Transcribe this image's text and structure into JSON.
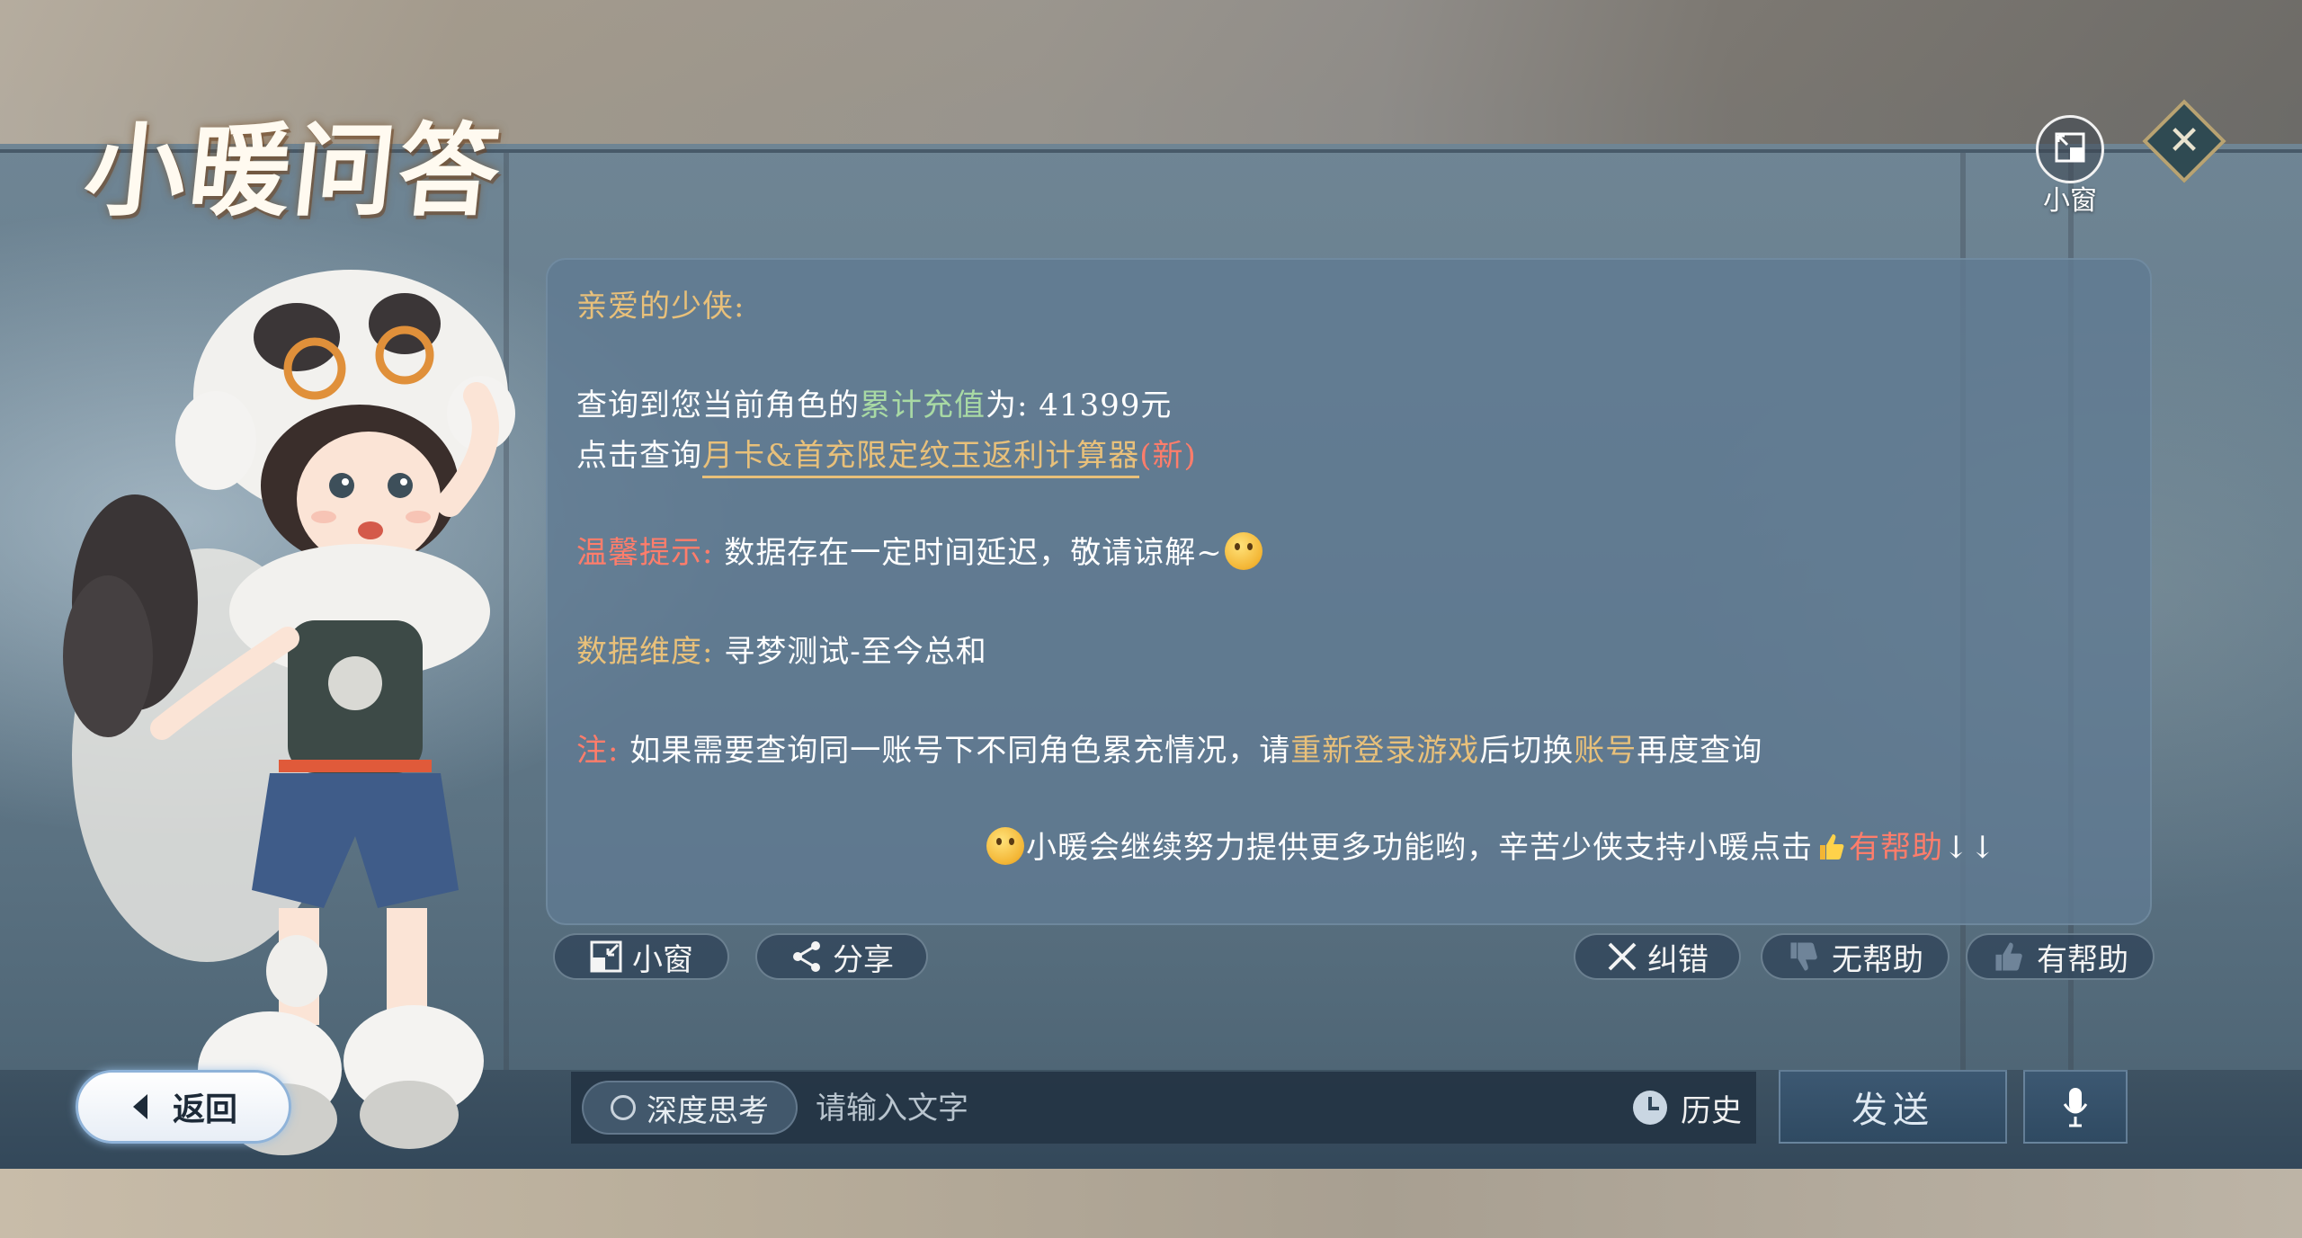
{
  "header": {
    "title": "小暖问答",
    "mini_window_label": "小窗"
  },
  "message": {
    "greeting": "亲爱的少侠:",
    "recharge_prefix": "查询到您当前角色的",
    "recharge_key": "累计充值",
    "recharge_mid": "为: ",
    "recharge_value": "41399元",
    "link_prefix": "点击查询",
    "link_text": "月卡&首充限定纹玉返利计算器",
    "link_new": "(新)",
    "tip_label": "温馨提示:",
    "tip_text": " 数据存在一定时间延迟，敬请谅解~",
    "dimension_label": "数据维度:",
    "dimension_value": " 寻梦测试-至今总和",
    "note_label": "注:",
    "note_text_1": " 如果需要查询同一账号下不同角色累充情况，请",
    "note_highlight_1": "重新登录游戏",
    "note_text_2": "后切换",
    "note_highlight_2": "账号",
    "note_text_3": "再度查询",
    "footer_text": "小暖会继续努力提供更多功能哟，辛苦少侠支持小暖点击",
    "footer_helpful": "有帮助",
    "footer_arrows": "↓↓"
  },
  "actions": {
    "mini_window": "小窗",
    "share": "分享",
    "correct": "纠错",
    "not_helpful": "无帮助",
    "helpful": "有帮助"
  },
  "bottom_bar": {
    "back": "返回",
    "deep_think": "深度思考",
    "input_placeholder": "请输入文字",
    "history": "历史",
    "send": "发送"
  },
  "colors": {
    "highlight_gold": "#e8c07a",
    "highlight_green": "#a8d9a4",
    "highlight_red": "#ff7d6b",
    "panel": "#607a92"
  }
}
